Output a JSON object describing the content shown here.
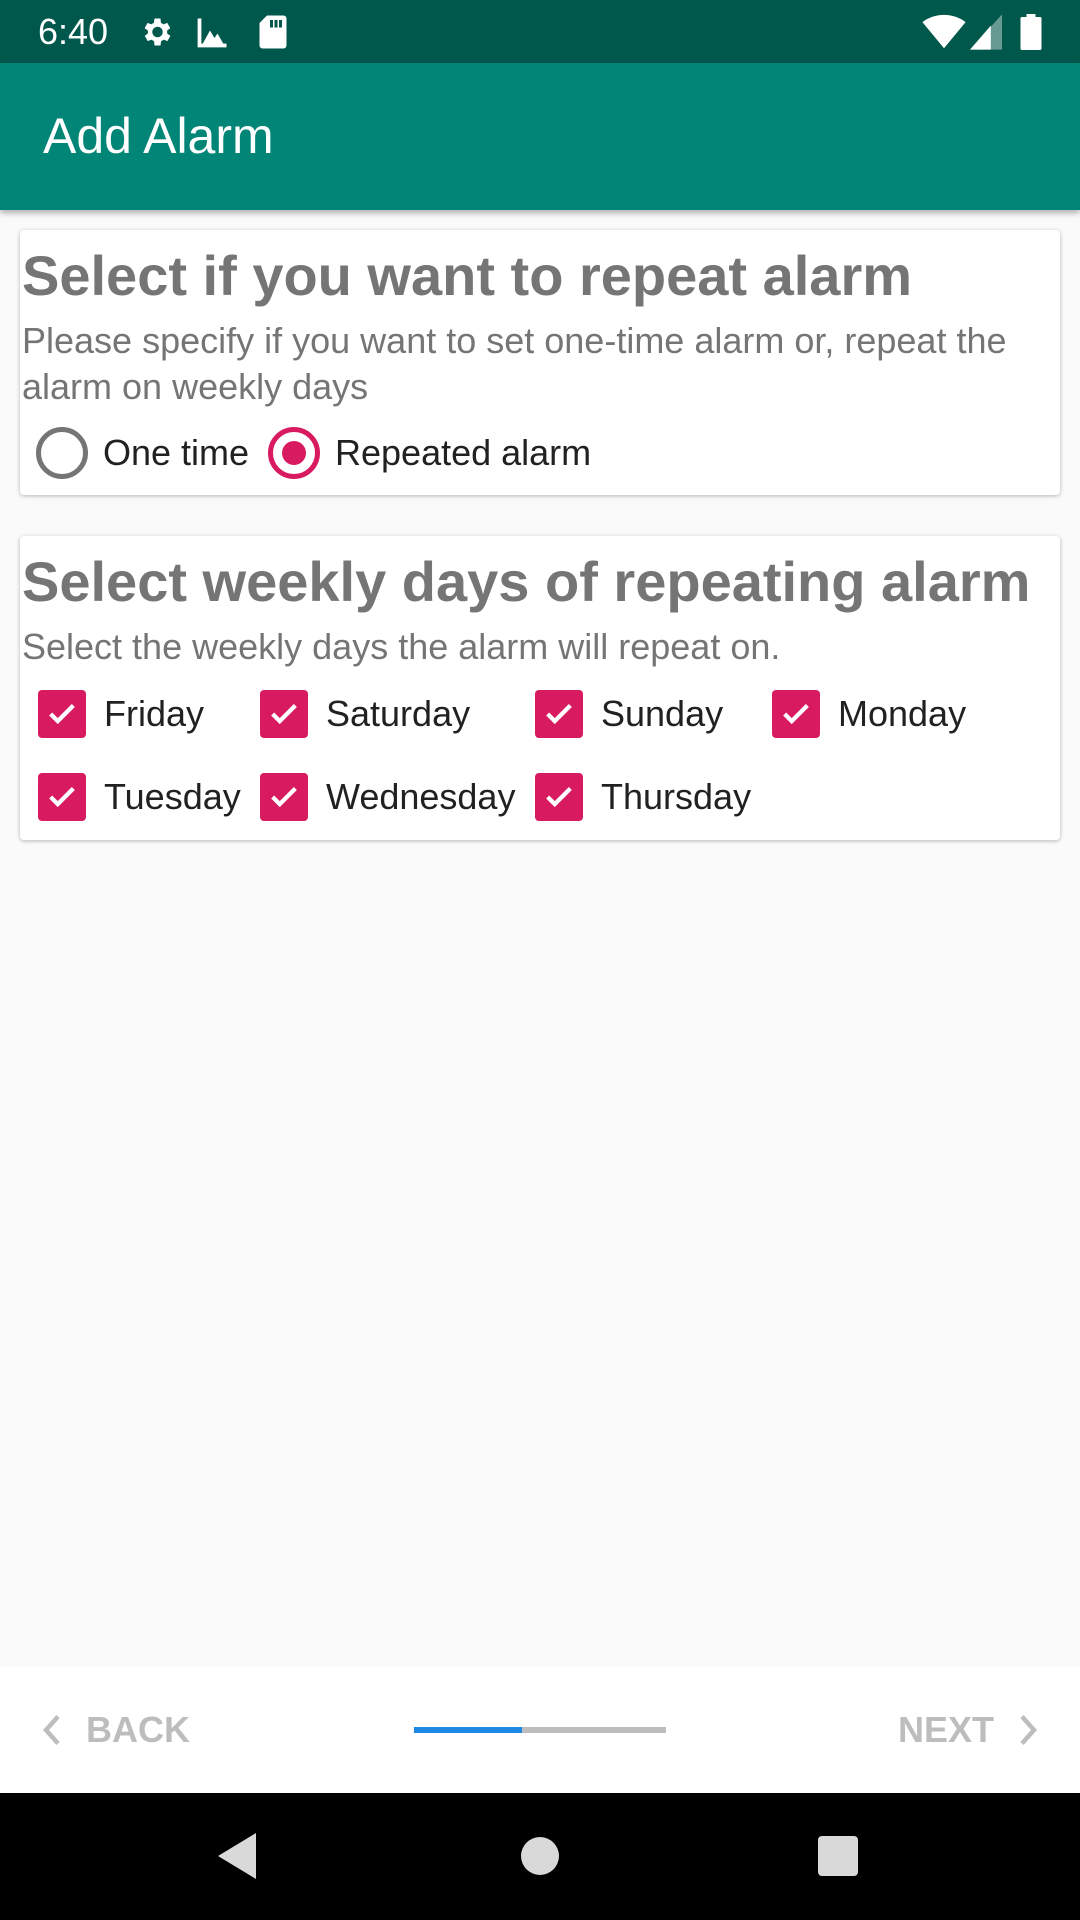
{
  "status_bar": {
    "time": "6:40",
    "left_icons": [
      "gear-icon",
      "image-icon",
      "sd-card-icon"
    ],
    "right_icons": [
      "wifi-icon",
      "cell-signal-icon",
      "battery-icon"
    ]
  },
  "app_bar": {
    "title": "Add Alarm"
  },
  "repeat_card": {
    "title": "Select if you want to repeat alarm",
    "description": "Please specify if you want to set one-time alarm or, repeat the alarm on weekly days",
    "options": [
      {
        "label": "One time",
        "selected": false
      },
      {
        "label": "Repeated alarm",
        "selected": true
      }
    ]
  },
  "days_card": {
    "title": "Select weekly days of repeating alarm",
    "description": "Select the weekly days the alarm will repeat on.",
    "days": [
      {
        "label": "Friday",
        "checked": true
      },
      {
        "label": "Saturday",
        "checked": true
      },
      {
        "label": "Sunday",
        "checked": true
      },
      {
        "label": "Monday",
        "checked": true
      },
      {
        "label": "Tuesday",
        "checked": true
      },
      {
        "label": "Wednesday",
        "checked": true
      },
      {
        "label": "Thursday",
        "checked": true
      }
    ]
  },
  "stepper": {
    "back_label": "BACK",
    "next_label": "NEXT",
    "progress_fraction": 0.43
  },
  "colors": {
    "status_bar": "#00574b",
    "app_bar": "#008577",
    "accent": "#d81b60",
    "progress": "#1e88e5"
  }
}
